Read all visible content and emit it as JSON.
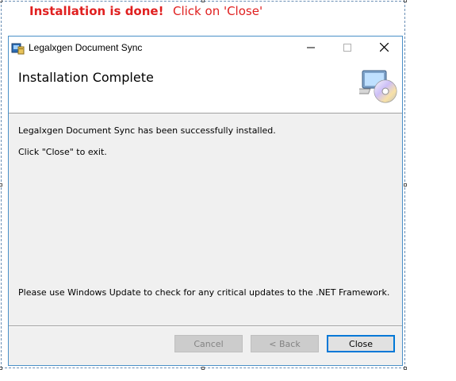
{
  "annotation": {
    "headline": "Installation is done!",
    "instruction": "Click on 'Close'",
    "color": "#e02020"
  },
  "window": {
    "title": "Legalxgen Document Sync",
    "app_icon": "installer-icon",
    "controls": {
      "minimize": "minimize-icon",
      "maximize": "maximize-icon",
      "close": "close-icon"
    }
  },
  "banner": {
    "title": "Installation Complete",
    "icon": "computer-cd-icon"
  },
  "body": {
    "line1": "Legalxgen Document Sync has been successfully installed.",
    "line2": "Click \"Close\" to exit.",
    "footer_note": "Please use Windows Update to check for any critical updates to the .NET Framework."
  },
  "buttons": {
    "cancel": "Cancel",
    "back": "< Back",
    "close": "Close"
  },
  "colors": {
    "accent": "#0078d7",
    "window_border": "#4a90c8"
  }
}
